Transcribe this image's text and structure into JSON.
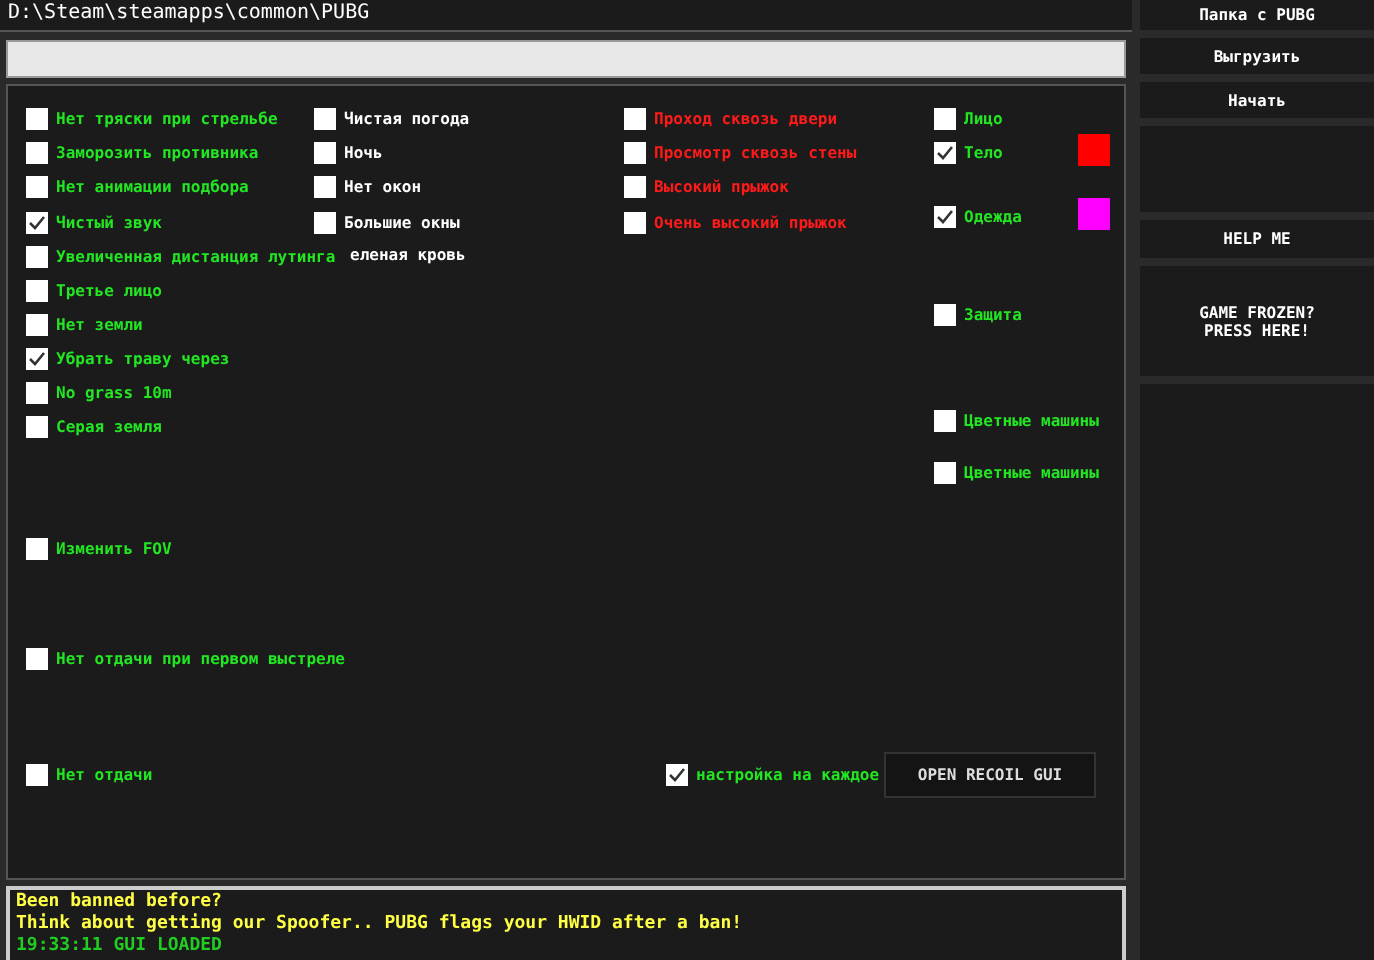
{
  "path_field": {
    "value": "D:\\Steam\\steamapps\\common\\PUBG"
  },
  "options": [
    {
      "label": "Нет тряски при стрельбе",
      "checked": false,
      "color": "#22e622"
    },
    {
      "label": "Заморозить противника",
      "checked": false,
      "color": "#22e622"
    },
    {
      "label": "Нет анимации подбора",
      "checked": false,
      "color": "#22e622"
    },
    {
      "label": "Чистый звук",
      "checked": true,
      "color": "#22e622"
    },
    {
      "label": "Увеличенная дистанция лутинга",
      "checked": false,
      "color": "#22e622"
    },
    {
      "label": "Третье лицо",
      "checked": false,
      "color": "#22e622"
    },
    {
      "label": "Нет земли",
      "checked": false,
      "color": "#22e622"
    },
    {
      "label": "Убрать траву через",
      "checked": true,
      "color": "#22e622"
    },
    {
      "label": "No grass 10m",
      "checked": false,
      "color": "#22e622"
    },
    {
      "label": "Серая земля",
      "checked": false,
      "color": "#22e622"
    },
    {
      "label": "Изменить FOV",
      "checked": false,
      "color": "#22e622"
    },
    {
      "label": "Нет отдачи при первом выстреле",
      "checked": false,
      "color": "#22e622"
    },
    {
      "label": "Нет отдачи",
      "checked": false,
      "color": "#22e622"
    },
    {
      "label": "Чистая погода",
      "checked": false,
      "color": "#ffffff"
    },
    {
      "label": "Ночь",
      "checked": false,
      "color": "#ffffff"
    },
    {
      "label": "Нет окон",
      "checked": false,
      "color": "#ffffff"
    },
    {
      "label": "Большие окны",
      "checked": false,
      "color": "#ffffff"
    },
    {
      "label": "еленая кровь",
      "kind": "covered",
      "color": "#ffffff"
    },
    {
      "label": "Проход сквозь двери",
      "checked": false,
      "color": "#ff1a1a"
    },
    {
      "label": "Просмотр сквозь стены",
      "checked": false,
      "color": "#ff1a1a"
    },
    {
      "label": "Высокий прыжок",
      "checked": false,
      "color": "#ff1a1a"
    },
    {
      "label": "Очень высокий прыжок",
      "checked": false,
      "color": "#ff1a1a"
    },
    {
      "label": "Лицо",
      "checked": false,
      "color": "#22e622"
    },
    {
      "label": "Тело",
      "checked": true,
      "color": "#22e622",
      "swatch": {
        "color": "#ff0000"
      }
    },
    {
      "label": "Одежда",
      "checked": true,
      "color": "#22e622",
      "swatch": {
        "color": "#ff00ff"
      }
    },
    {
      "label": "Защита",
      "checked": false,
      "color": "#22e622"
    },
    {
      "label": "Цветные машины",
      "checked": false,
      "color": "#22e622"
    },
    {
      "label": "Цветные машины",
      "checked": false,
      "color": "#22e622"
    },
    {
      "label": "настройка на каждое",
      "checked": true,
      "color": "#22e622"
    }
  ],
  "recoil_button": "OPEN RECOIL GUI",
  "log": [
    {
      "text": "Been banned before?",
      "color": "#ffff44"
    },
    {
      "text": "Think about getting our Spoofer.. PUBG flags your HWID after a ban!",
      "color": "#ffff44"
    },
    {
      "text": "19:33:11 GUI LOADED",
      "color": "#22cc22"
    }
  ],
  "sidebar": {
    "buttons": [
      "Папка с PUBG",
      "Выгрузить",
      "Начать"
    ],
    "help_button": "HELP ME",
    "frozen_button": "GAME FROZEN?\nPRESS HERE!"
  }
}
